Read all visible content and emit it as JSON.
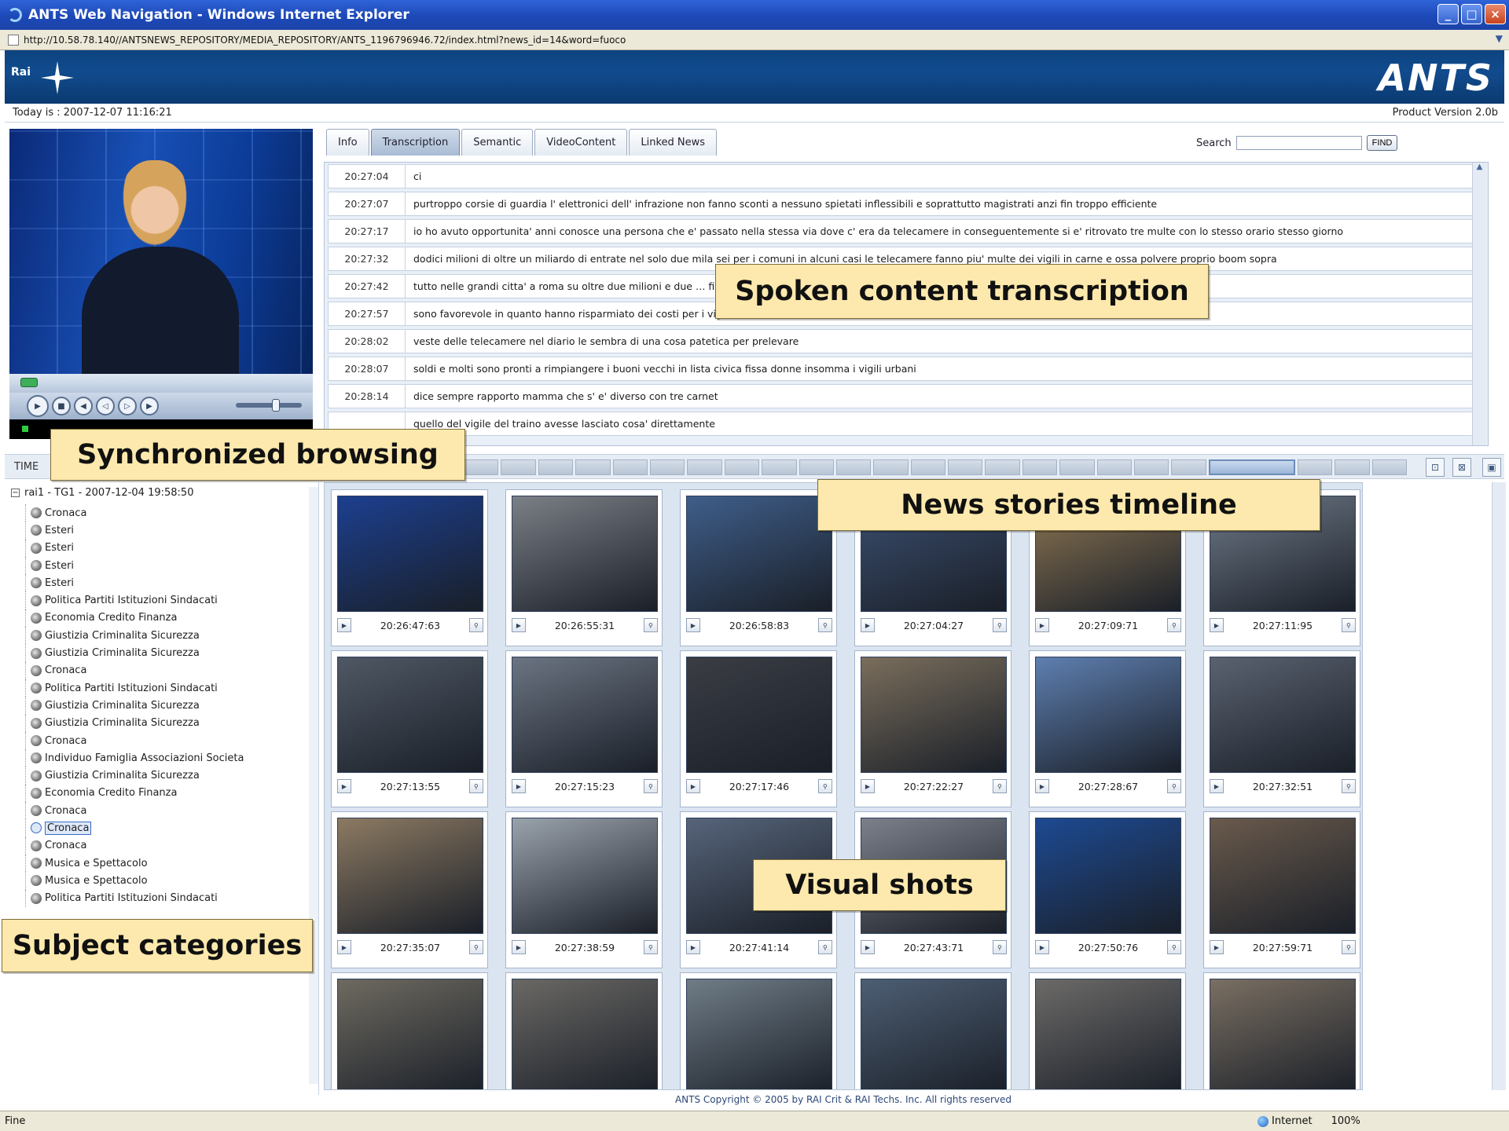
{
  "window": {
    "title": "ANTS Web Navigation - Windows Internet Explorer",
    "buttons": [
      "_",
      "□",
      "×"
    ]
  },
  "address": {
    "url": "http://10.58.78.140//ANTSNEWS_REPOSITORY/MEDIA_REPOSITORY/ANTS_1196796946.72/index.html?news_id=14&word=fuoco"
  },
  "banner": {
    "logo_text": "Rai",
    "app_name": "ANTS"
  },
  "info": {
    "today": "Today is : 2007-12-07 11:16:21",
    "version": "Product Version 2.0b"
  },
  "tabs": [
    "Info",
    "Transcription",
    "Semantic",
    "VideoContent",
    "Linked News"
  ],
  "active_tab": "Transcription",
  "search": {
    "label": "Search",
    "value": "",
    "button": "FIND"
  },
  "transcription": [
    {
      "time": "20:27:04",
      "text": "ci"
    },
    {
      "time": "20:27:07",
      "text": "purtroppo corsie di guardia l' elettronici dell' infrazione non fanno sconti a nessuno spietati inflessibili e soprattutto magistrati anzi fin troppo efficiente"
    },
    {
      "time": "20:27:17",
      "text": "io ho avuto opportunita' anni conosce una persona che e' passato nella stessa via dove c' era da telecamere in conseguentemente si e' ritrovato tre multe con lo stesso orario stesso giorno"
    },
    {
      "time": "20:27:32",
      "text": "dodici milioni di oltre un miliardo di entrate nel solo due mila sei per i comuni in alcuni casi le telecamere fanno piu' multe dei vigili in carne e ossa polvere proprio boom sopra"
    },
    {
      "time": "20:27:42",
      "text": "tutto nelle grandi citta' a roma su oltre due milioni e due … firenze addirittura rispettivamente sessantacinque e sessanta %"
    },
    {
      "time": "20:27:57",
      "text": "sono favorevole in quanto hanno risparmiato dei costi per i vigili urbani"
    },
    {
      "time": "20:28:02",
      "text": "veste delle telecamere nel diario le sembra di una cosa patetica per prelevare"
    },
    {
      "time": "20:28:07",
      "text": "soldi e molti sono pronti a rimpiangere i buoni vecchi in lista civica fissa donne insomma i vigili urbani"
    },
    {
      "time": "20:28:14",
      "text": "dice sempre rapporto mamma che s' e' diverso con tre carnet"
    },
    {
      "time": "",
      "text": "quello del vigile del traino avesse lasciato cosa' direttamente"
    }
  ],
  "timeline": {
    "label": "TIME",
    "segments": 24,
    "current_segment": 20
  },
  "tree": {
    "root": "rai1 - TG1 - 2007-12-04 19:58:50",
    "items": [
      "Cronaca",
      "Esteri",
      "Esteri",
      "Esteri",
      "Esteri",
      "Politica Partiti Istituzioni Sindacati",
      "Economia Credito Finanza",
      "Giustizia Criminalita Sicurezza",
      "Giustizia Criminalita Sicurezza",
      "Cronaca",
      "Politica Partiti Istituzioni Sindacati",
      "Giustizia Criminalita Sicurezza",
      "Giustizia Criminalita Sicurezza",
      "Cronaca",
      "Individuo Famiglia Associazioni Societa",
      "Giustizia Criminalita Sicurezza",
      "Economia Credito Finanza",
      "Cronaca",
      "Cronaca",
      "Cronaca",
      "Musica e Spettacolo",
      "Musica e Spettacolo",
      "Politica Partiti Istituzioni Sindacati"
    ],
    "selected_index": 18
  },
  "shots": [
    {
      "time": "20:26:47:63",
      "color": "#1c3f8f"
    },
    {
      "time": "20:26:55:31",
      "color": "#7b7f86"
    },
    {
      "time": "20:26:58:83",
      "color": "#3f5e8a"
    },
    {
      "time": "20:27:04:27",
      "color": "#3b4f70"
    },
    {
      "time": "20:27:09:71",
      "color": "#8e7753"
    },
    {
      "time": "20:27:11:95",
      "color": "#6f7a88"
    },
    {
      "time": "20:27:13:55",
      "color": "#4f5864"
    },
    {
      "time": "20:27:15:23",
      "color": "#6b7482"
    },
    {
      "time": "20:27:17:46",
      "color": "#3a3d44"
    },
    {
      "time": "20:27:22:27",
      "color": "#7a6e5c"
    },
    {
      "time": "20:27:28:67",
      "color": "#5e7fb0"
    },
    {
      "time": "20:27:32:51",
      "color": "#5a6270"
    },
    {
      "time": "20:27:35:07",
      "color": "#8c7a62"
    },
    {
      "time": "20:27:38:59",
      "color": "#9aa2ab"
    },
    {
      "time": "20:27:41:14",
      "color": "#56647a"
    },
    {
      "time": "20:27:43:71",
      "color": "#7c808a"
    },
    {
      "time": "20:27:50:76",
      "color": "#1d4a92"
    },
    {
      "time": "20:27:59:71",
      "color": "#6a5a4c"
    },
    {
      "time": "",
      "color": "#6e6a60"
    },
    {
      "time": "",
      "color": "#6a6864"
    },
    {
      "time": "",
      "color": "#6f7c86"
    },
    {
      "time": "",
      "color": "#4d5e73"
    },
    {
      "time": "",
      "color": "#6c6a68"
    },
    {
      "time": "",
      "color": "#7a6f62"
    }
  ],
  "footer": "ANTS Copyright © 2005 by RAI Crit & RAI Techs. Inc. All rights reserved",
  "statusbar": {
    "left": "Fine",
    "zone": "Internet",
    "zoom": "100%"
  },
  "callouts": {
    "transcription": "Spoken content transcription",
    "sync": "Synchronized browsing",
    "timeline": "News stories timeline",
    "shots": "Visual shots",
    "categories": "Subject categories"
  }
}
